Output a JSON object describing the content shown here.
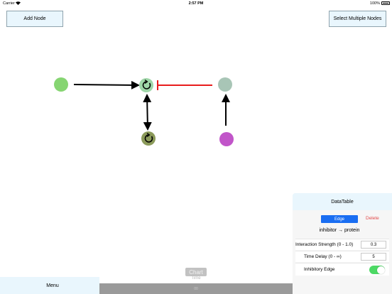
{
  "status": {
    "carrier": "Carrier",
    "time": "2:57 PM",
    "battery": "100%"
  },
  "toolbar": {
    "add_node_label": "Add Node",
    "select_multiple_label": "Select Multiple Nodes"
  },
  "graph": {
    "nodes": [
      {
        "id": "n1",
        "color": "#86d572",
        "self_loop": false
      },
      {
        "id": "n2",
        "color": "#9fd6a8",
        "self_loop": true
      },
      {
        "id": "n3",
        "color": "#a8c5b6",
        "self_loop": false
      },
      {
        "id": "n4",
        "color": "#8b9a5a",
        "self_loop": true
      },
      {
        "id": "n5",
        "color": "#c155c9",
        "self_loop": false
      }
    ],
    "edges": [
      {
        "from": "n1",
        "to": "n2",
        "inhibitory": false
      },
      {
        "from": "n3",
        "to": "n2",
        "inhibitory": true
      },
      {
        "from": "n2",
        "to": "n4",
        "inhibitory": false,
        "bidirectional": true
      },
      {
        "from": "n5",
        "to": "n3",
        "inhibitory": false
      }
    ],
    "colors": {
      "activating": "#000000",
      "inhibitory": "#e81c1c"
    }
  },
  "bottom": {
    "menu_label": "Menu",
    "chart_label": "Chart",
    "time_label": "Time",
    "time_value": "00"
  },
  "datatable": {
    "title": "DataTable",
    "segment_label": "Edge",
    "delete_label": "Delete",
    "edge_description": "inhibitor → protein",
    "strength_label": "Interaction Strength (0 - 1.0)",
    "strength_value": "0.3",
    "delay_label": "Time Delay (0 - ∞)",
    "delay_value": "5",
    "inhibitory_label": "Inhibitory Edge",
    "inhibitory_on": true
  }
}
